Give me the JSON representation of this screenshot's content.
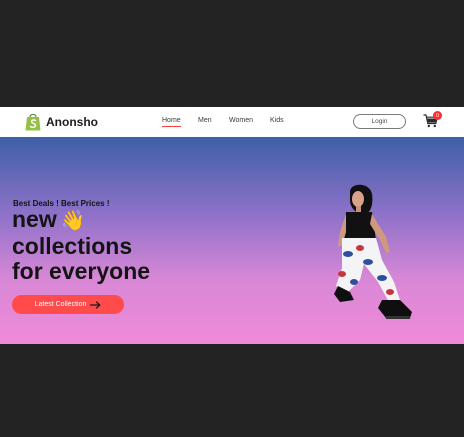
{
  "brand": {
    "name": "Anonsho",
    "logo_icon": "shopify-bag-icon",
    "logo_color": "#95bf47"
  },
  "nav": {
    "items": [
      {
        "label": "Home",
        "active": true
      },
      {
        "label": "Men",
        "active": false
      },
      {
        "label": "Women",
        "active": false
      },
      {
        "label": "Kids",
        "active": false
      }
    ]
  },
  "header": {
    "login_label": "Login",
    "cart_icon": "cart-icon",
    "cart_count": "0",
    "accent": "#ff4141"
  },
  "hero": {
    "tagline": "Best Deals ! Best Prices !",
    "headline_line1": "new",
    "headline_emoji": "👋",
    "headline_line2": "collections",
    "headline_line3": "for everyone",
    "cta_label": "Latest Collection",
    "cta_icon": "arrow-right-icon",
    "cta_color": "#ff4b4b",
    "image": "model-photo"
  }
}
